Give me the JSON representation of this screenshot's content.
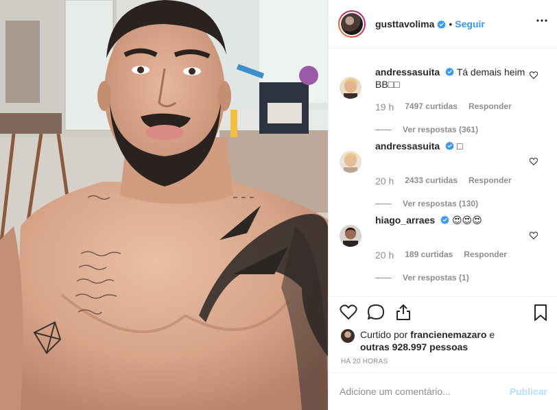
{
  "post": {
    "author": "gusttavolima",
    "follow_label": "Seguir",
    "separator": "•"
  },
  "comments": [
    {
      "user": "andressasuita",
      "text": "Tá demais heim BB□□",
      "time": "19 h",
      "likes": "7497 curtidas",
      "reply": "Responder",
      "view_replies": "Ver respostas (361)"
    },
    {
      "user": "andressasuita",
      "text": "□",
      "time": "20 h",
      "likes": "2433 curtidas",
      "reply": "Responder",
      "view_replies": "Ver respostas (130)"
    },
    {
      "user": "hiago_arraes",
      "text": "😍😍😍",
      "time": "20 h",
      "likes": "189 curtidas",
      "reply": "Responder",
      "view_replies": "Ver respostas (1)"
    }
  ],
  "likes": {
    "prefix": "Curtido por",
    "user": "francienemazaro",
    "middle": "e",
    "others": "outras 928.997 pessoas"
  },
  "timestamp": "HÁ 20 HORAS",
  "composer": {
    "placeholder": "Adicione um comentário...",
    "publish": "Publicar"
  },
  "colors": {
    "link_blue": "#3897f0",
    "verified_blue": "#3897f0",
    "muted": "#8e8e8e",
    "publish_disabled": "#b2dffc"
  }
}
